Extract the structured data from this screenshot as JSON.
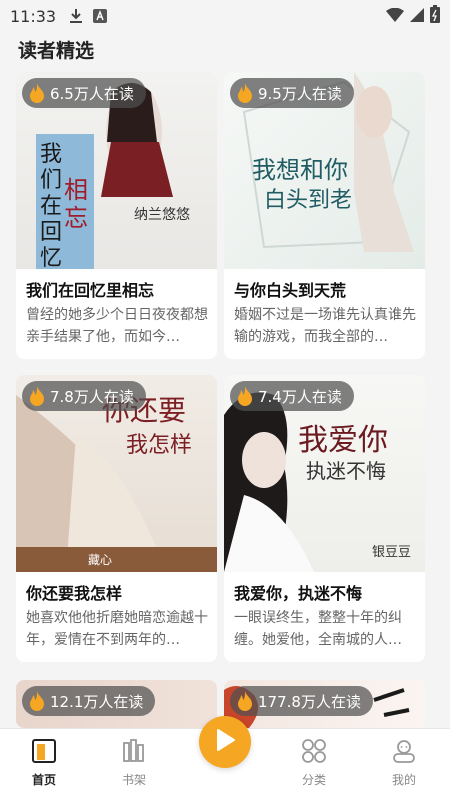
{
  "status_bar": {
    "time": "11:33"
  },
  "section": {
    "title": "读者精选"
  },
  "books": [
    {
      "title": "我们在回忆里相忘",
      "readers": "6.5万人在读",
      "desc": "曾经的她多少个日日夜夜都想亲手结果了他，而如今…",
      "cover_title": "我们在回忆里相忘",
      "cover_author": "纳兰悠悠"
    },
    {
      "title": "与你白头到天荒",
      "readers": "9.5万人在读",
      "desc": "婚姻不过是一场谁先认真谁先输的游戏，而我全部的…",
      "cover_title_1": "我想和你",
      "cover_title_2": "白头到老"
    },
    {
      "title": "你还要我怎样",
      "readers": "7.8万人在读",
      "desc": "她喜欢他他折磨她暗恋逾越十年，爱情在不到两年的…",
      "cover_title_1": "你还要",
      "cover_title_2": "我怎样",
      "cover_author": "藏心"
    },
    {
      "title": "我爱你，执迷不悔",
      "readers": "7.4万人在读",
      "desc": "一眼误终生，整整十年的纠缠。她爱他，全南城的人…",
      "cover_title_1": "我爱你",
      "cover_title_2": "执迷不悔",
      "cover_author": "银豆豆"
    },
    {
      "readers": "12.1万人在读"
    },
    {
      "readers": "177.8万人在读"
    }
  ],
  "tabs": [
    {
      "label": "首页",
      "icon": "home-book-icon",
      "active": true
    },
    {
      "label": "书架",
      "icon": "bookshelf-icon"
    },
    {
      "label": "分类",
      "icon": "category-icon"
    },
    {
      "label": "我的",
      "icon": "profile-icon"
    }
  ],
  "colors": {
    "accent": "#f5a623",
    "flame": "#f5a623"
  }
}
